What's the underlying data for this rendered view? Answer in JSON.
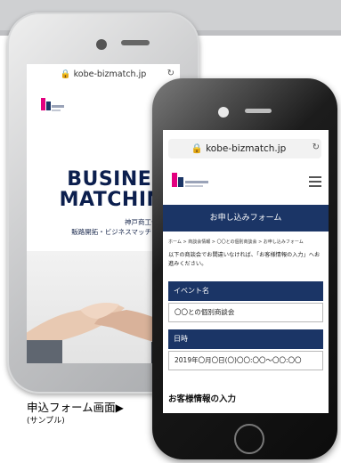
{
  "back_phone": {
    "url": "kobe-bizmatch.jp",
    "hero_title_line1": "BUSINESS",
    "hero_title_line2": "MATCHING",
    "hero_sub_line1": "神戸商工会議所の",
    "hero_sub_line2": "販路開拓・ビジネスマッチング事業"
  },
  "front_phone": {
    "url": "kobe-bizmatch.jp",
    "page_banner": "お申し込みフォーム",
    "breadcrumb": "ホーム > 商談会情報 > 〇〇との個別商談会 > お申し込みフォーム",
    "intro_text": "以下の商談会でお間違いなければ、「お客様情報の入力」へお進みください。",
    "event_label": "イベント名",
    "event_value": "〇〇との個別商談会",
    "datetime_label": "日時",
    "datetime_value": "2019年〇月〇日(〇)〇〇:〇〇～〇〇:〇〇",
    "customer_info_title": "お客様情報の入力"
  },
  "caption": {
    "title": "申込フォーム画面",
    "arrow": "▶",
    "subtitle": "(サンプル)"
  },
  "colors": {
    "navy": "#1b3566",
    "hero_text": "#0c1f4e"
  }
}
